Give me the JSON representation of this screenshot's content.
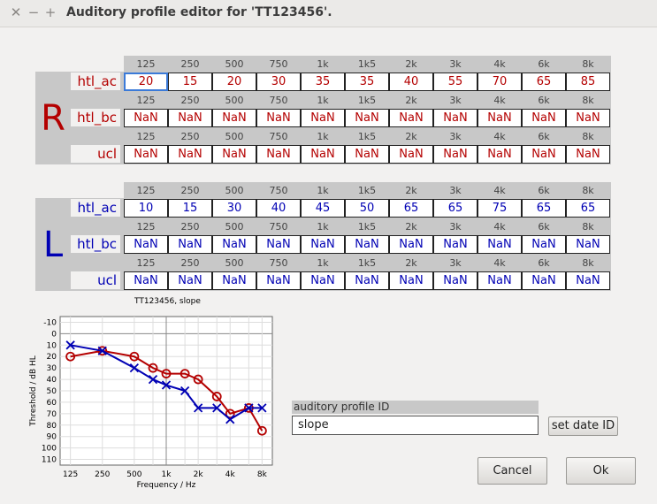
{
  "window": {
    "title": "Auditory profile editor for 'TT123456'."
  },
  "frequencies": [
    "125",
    "250",
    "500",
    "750",
    "1k",
    "1k5",
    "2k",
    "3k",
    "4k",
    "6k",
    "8k"
  ],
  "right": {
    "letter": "R",
    "color": "#b40000",
    "rows": [
      {
        "label": "htl_ac",
        "values": [
          "20",
          "15",
          "20",
          "30",
          "35",
          "35",
          "40",
          "55",
          "70",
          "65",
          "85"
        ]
      },
      {
        "label": "htl_bc",
        "values": [
          "NaN",
          "NaN",
          "NaN",
          "NaN",
          "NaN",
          "NaN",
          "NaN",
          "NaN",
          "NaN",
          "NaN",
          "NaN"
        ]
      },
      {
        "label": "ucl",
        "values": [
          "NaN",
          "NaN",
          "NaN",
          "NaN",
          "NaN",
          "NaN",
          "NaN",
          "NaN",
          "NaN",
          "NaN",
          "NaN"
        ]
      }
    ]
  },
  "left": {
    "letter": "L",
    "color": "#0000b4",
    "rows": [
      {
        "label": "htl_ac",
        "values": [
          "10",
          "15",
          "30",
          "40",
          "45",
          "50",
          "65",
          "65",
          "75",
          "65",
          "65"
        ]
      },
      {
        "label": "htl_bc",
        "values": [
          "NaN",
          "NaN",
          "NaN",
          "NaN",
          "NaN",
          "NaN",
          "NaN",
          "NaN",
          "NaN",
          "NaN",
          "NaN"
        ]
      },
      {
        "label": "ucl",
        "values": [
          "NaN",
          "NaN",
          "NaN",
          "NaN",
          "NaN",
          "NaN",
          "NaN",
          "NaN",
          "NaN",
          "NaN",
          "NaN"
        ]
      }
    ]
  },
  "plot": {
    "title": "TT123456, slope",
    "ylabel": "Threshold / dB HL",
    "xlabel": "Frequency / Hz",
    "yticks": [
      "-10",
      "0",
      "10",
      "20",
      "30",
      "40",
      "50",
      "60",
      "70",
      "80",
      "90",
      "100",
      "110"
    ],
    "xticks": [
      "125",
      "250",
      "500",
      "1k",
      "2k",
      "4k",
      "8k"
    ]
  },
  "chart_data": {
    "type": "line",
    "title": "TT123456, slope",
    "xlabel": "Frequency / Hz",
    "ylabel": "Threshold / dB HL",
    "x": [
      125,
      250,
      500,
      750,
      1000,
      1500,
      2000,
      3000,
      4000,
      6000,
      8000
    ],
    "ylim": [
      115,
      -15
    ],
    "xscale": "log",
    "series": [
      {
        "name": "R htl_ac",
        "color": "#b40000",
        "marker": "circle",
        "values": [
          20,
          15,
          20,
          30,
          35,
          35,
          40,
          55,
          70,
          65,
          85
        ]
      },
      {
        "name": "L htl_ac",
        "color": "#0000b4",
        "marker": "x",
        "values": [
          10,
          15,
          30,
          40,
          45,
          50,
          65,
          65,
          75,
          65,
          65
        ]
      }
    ],
    "grid": true
  },
  "profile_id": {
    "label": "auditory profile ID",
    "value": "slope"
  },
  "buttons": {
    "set_date": "set date ID",
    "cancel": "Cancel",
    "ok": "Ok"
  }
}
